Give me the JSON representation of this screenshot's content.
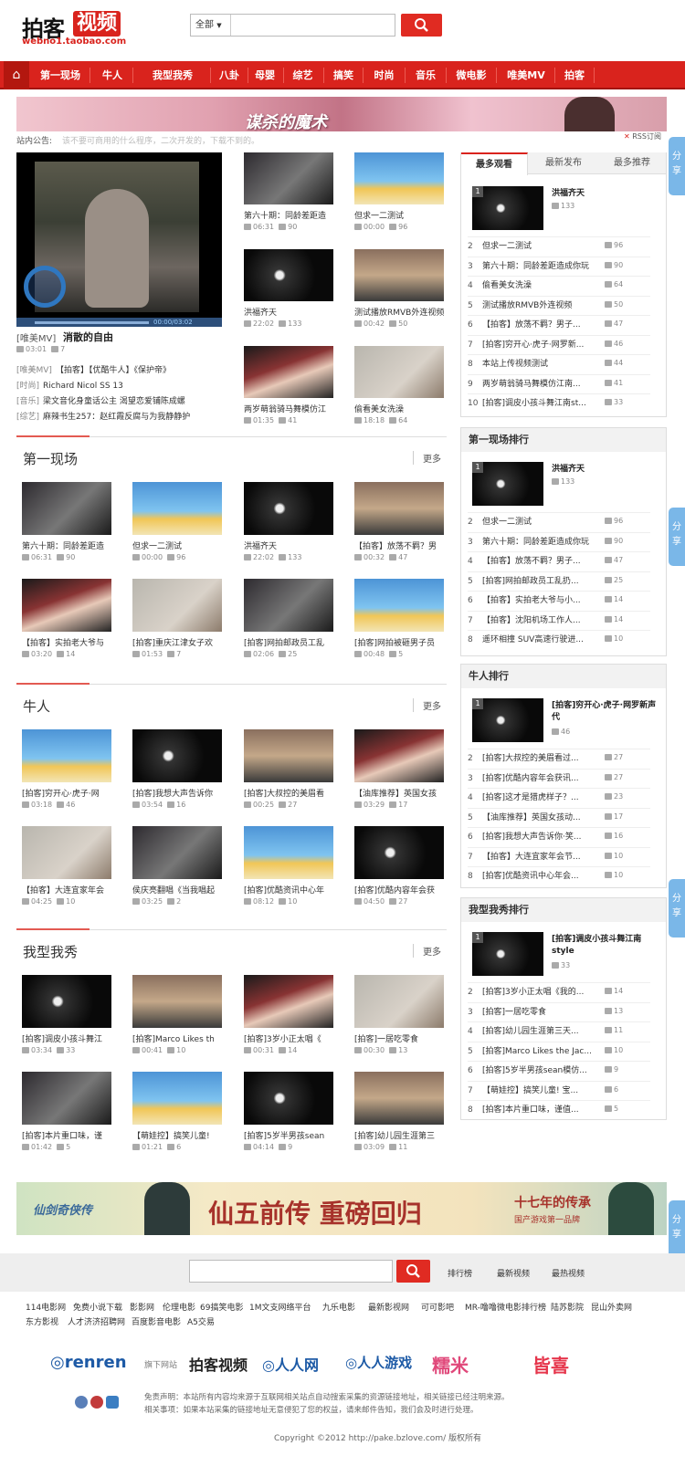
{
  "header": {
    "logo_main": "拍客",
    "logo_sub": "视频",
    "logo_url": "webno1.taobao.com",
    "search_category": "全部"
  },
  "nav": {
    "home_icon": "home-icon",
    "items": [
      "第一现场",
      "牛人",
      "我型我秀",
      "八卦",
      "母婴",
      "综艺",
      "搞笑",
      "时尚",
      "音乐",
      "微电影",
      "唯美MV",
      "拍客"
    ]
  },
  "banner_top": {
    "text": "谋杀的魔术"
  },
  "announcement": {
    "label": "站内公告:",
    "text": "该不要可商用的什么程序，二次开发的，下载不到的。",
    "rss": "RSS订阅"
  },
  "featured": {
    "tag": "[唯美MV]",
    "title": "消散的自由",
    "time": "03:01",
    "count": "7",
    "player_time": "00:00/03:02",
    "list": [
      {
        "tag": "[唯美MV]",
        "text": "【拍客】【优酷牛人】《保护帝》"
      },
      {
        "tag": "[时尚]",
        "text": "Richard Nicol SS 13"
      },
      {
        "tag": "[音乐]",
        "text": "梁文音化身童话公主 渴望恋爱铺陈成螺"
      },
      {
        "tag": "[综艺]",
        "text": "麻辣书生257：赵红霞反腐与为我静静护"
      }
    ]
  },
  "top_grid": [
    {
      "title": "第六十期：同龄差距造",
      "time": "06:31",
      "count": "90"
    },
    {
      "title": "但求一二测试",
      "time": "00:00",
      "count": "96"
    },
    {
      "title": "洪福齐天",
      "time": "22:02",
      "count": "133"
    },
    {
      "title": "测试播放RMVB外连视频",
      "time": "00:42",
      "count": "50"
    },
    {
      "title": "两岁萌翁骑马舞模仿江",
      "time": "01:35",
      "count": "41"
    },
    {
      "title": "偷看美女洗澡",
      "time": "18:18",
      "count": "64"
    }
  ],
  "sections": [
    {
      "title": "第一现场",
      "more": "更多",
      "items": [
        {
          "title": "第六十期：同龄差距造",
          "time": "06:31",
          "count": "90"
        },
        {
          "title": "但求一二测试",
          "time": "00:00",
          "count": "96"
        },
        {
          "title": "洪福齐天",
          "time": "22:02",
          "count": "133"
        },
        {
          "title": "【拍客】放荡不羁？男",
          "time": "00:32",
          "count": "47"
        },
        {
          "title": "【拍客】实拍老大爷与",
          "time": "03:20",
          "count": "14"
        },
        {
          "title": "[拍客]重庆江津女子欢",
          "time": "01:53",
          "count": "7"
        },
        {
          "title": "[拍客]网拍邮政员工乱",
          "time": "02:06",
          "count": "25"
        },
        {
          "title": "[拍客]网拍被砸男子员",
          "time": "00:48",
          "count": "5"
        }
      ]
    },
    {
      "title": "牛人",
      "more": "更多",
      "items": [
        {
          "title": "[拍客]穷开心·虎子·网",
          "time": "03:18",
          "count": "46"
        },
        {
          "title": "[拍客]我想大声告诉你",
          "time": "03:54",
          "count": "16"
        },
        {
          "title": "[拍客]大叔控的美眉看",
          "time": "00:25",
          "count": "27"
        },
        {
          "title": "【油库推荐】英国女孩",
          "time": "03:29",
          "count": "17"
        },
        {
          "title": "【拍客】大连宜家年会",
          "time": "04:25",
          "count": "10"
        },
        {
          "title": "侯庆亮翻唱《当我唱起",
          "time": "03:25",
          "count": "2"
        },
        {
          "title": "[拍客]优酷资讯中心年",
          "time": "08:12",
          "count": "10"
        },
        {
          "title": "[拍客]优酷内容年会获",
          "time": "04:50",
          "count": "27"
        }
      ]
    },
    {
      "title": "我型我秀",
      "more": "更多",
      "items": [
        {
          "title": "[拍客]调皮小孩斗舞江",
          "time": "03:34",
          "count": "33"
        },
        {
          "title": "[拍客]Marco Likes th",
          "time": "00:41",
          "count": "10"
        },
        {
          "title": "[拍客]3岁小正太唱《",
          "time": "00:31",
          "count": "14"
        },
        {
          "title": "[拍客]一居吃零食",
          "time": "00:30",
          "count": "13"
        },
        {
          "title": "[拍客]本片重口味，谨",
          "time": "01:42",
          "count": "5"
        },
        {
          "title": "【萌娃控】搞笑儿童!",
          "time": "01:21",
          "count": "6"
        },
        {
          "title": "[拍客]5岁半男孩sean",
          "time": "04:14",
          "count": "9"
        },
        {
          "title": "[拍客]幼儿园生涯第三",
          "time": "03:09",
          "count": "11"
        }
      ]
    }
  ],
  "rank_tabs": [
    "最多观看",
    "最新发布",
    "最多推荐"
  ],
  "rank_main": {
    "top": {
      "title": "洪福齐天",
      "count": "133"
    },
    "rows": [
      {
        "n": "2",
        "t": "但求一二测试",
        "c": "96"
      },
      {
        "n": "3",
        "t": "第六十期：同龄差距造成你玩",
        "c": "90"
      },
      {
        "n": "4",
        "t": "偷看美女洗澡",
        "c": "64"
      },
      {
        "n": "5",
        "t": "测试播放RMVB外连视频",
        "c": "50"
      },
      {
        "n": "6",
        "t": "【拍客】放荡不羁？男子...",
        "c": "47"
      },
      {
        "n": "7",
        "t": "[拍客]穷开心·虎子·网罗新...",
        "c": "46"
      },
      {
        "n": "8",
        "t": "本站上传视频测试",
        "c": "44"
      },
      {
        "n": "9",
        "t": "两岁萌翁骑马舞模仿江南...",
        "c": "41"
      },
      {
        "n": "10",
        "t": "[拍客]调皮小孩斗舞江南st...",
        "c": "33"
      }
    ]
  },
  "rank_panels": [
    {
      "title": "第一现场排行",
      "top": {
        "title": "洪福齐天",
        "count": "133"
      },
      "rows": [
        {
          "n": "2",
          "t": "但求一二测试",
          "c": "96"
        },
        {
          "n": "3",
          "t": "第六十期：同龄差距造成你玩",
          "c": "90"
        },
        {
          "n": "4",
          "t": "【拍客】放荡不羁？男子...",
          "c": "47"
        },
        {
          "n": "5",
          "t": "[拍客]网拍邮政员工乱扔...",
          "c": "25"
        },
        {
          "n": "6",
          "t": "【拍客】实拍老大爷与小...",
          "c": "14"
        },
        {
          "n": "7",
          "t": "【拍客】沈阳机场工作人...",
          "c": "14"
        },
        {
          "n": "8",
          "t": "遥环相撞 SUV高速行驶进...",
          "c": "10"
        }
      ]
    },
    {
      "title": "牛人排行",
      "top": {
        "title": "[拍客]穷开心·虎子·网罗新声代",
        "count": "46"
      },
      "rows": [
        {
          "n": "2",
          "t": "[拍客]大叔控的美眉看过...",
          "c": "27"
        },
        {
          "n": "3",
          "t": "[拍客]优酷内容年会获讯...",
          "c": "27"
        },
        {
          "n": "4",
          "t": "[拍客]这才是猎虎样子？...",
          "c": "23"
        },
        {
          "n": "5",
          "t": "【油库推荐】英国女孩动...",
          "c": "17"
        },
        {
          "n": "6",
          "t": "[拍客]我想大声告诉你·笑...",
          "c": "16"
        },
        {
          "n": "7",
          "t": "【拍客】大连宜家年会节...",
          "c": "10"
        },
        {
          "n": "8",
          "t": "[拍客]优酷资讯中心年会...",
          "c": "10"
        }
      ]
    },
    {
      "title": "我型我秀排行",
      "top": {
        "title": "[拍客]调皮小孩斗舞江南style",
        "count": "33"
      },
      "rows": [
        {
          "n": "2",
          "t": "[拍客]3岁小正太唱《我的...",
          "c": "14"
        },
        {
          "n": "3",
          "t": "[拍客]一居吃零食",
          "c": "13"
        },
        {
          "n": "4",
          "t": "[拍客]幼儿园生涯第三天...",
          "c": "11"
        },
        {
          "n": "5",
          "t": "[拍客]Marco Likes the Jac...",
          "c": "10"
        },
        {
          "n": "6",
          "t": "[拍客]5岁半男孩sean模仿...",
          "c": "9"
        },
        {
          "n": "7",
          "t": "【萌娃控】搞笑儿童! 宝...",
          "c": "6"
        },
        {
          "n": "8",
          "t": "[拍客]本片重口味，谨值...",
          "c": "5"
        }
      ]
    }
  ],
  "share_label": "分享",
  "bottom_banner": {
    "left_text": "仙剑奇侠传",
    "main_text": "仙五前传 重磅回归",
    "right_text": "十七年的传承",
    "right_sub": "国产游戏第一品牌"
  },
  "footer": {
    "links": [
      "排行榜",
      "最新视频",
      "最热视频"
    ],
    "friend_links": [
      "114电影网",
      "免费小说下载",
      "影影网",
      "伦理电影",
      "69搞笑电影",
      "1M文支网络平台",
      "九乐电影",
      "最新影视网",
      "可可影吧",
      "MR-噜噜",
      "微电影排行榜",
      "陆苏影院",
      "昆山外卖网",
      "东方影视",
      "人才济济招聘网",
      "百度影音电影",
      "A5交易"
    ],
    "partners": [
      "renren",
      "旗下网站",
      "拍客视频",
      "人人网",
      "人人游戏",
      "糯米",
      "皆喜"
    ],
    "disclaimer1": "免责声明：本站所有内容均来源于互联网相关站点自动搜索采集的资源链接地址，相关链接已经注明来源。",
    "disclaimer2": "相关事项：如果本站采集的链接地址无意侵犯了您的权益，请来邮件告知，我们会及时进行处理。",
    "copyright": "Copyright ©2012 http://pake.bzlove.com/ 版权所有"
  }
}
